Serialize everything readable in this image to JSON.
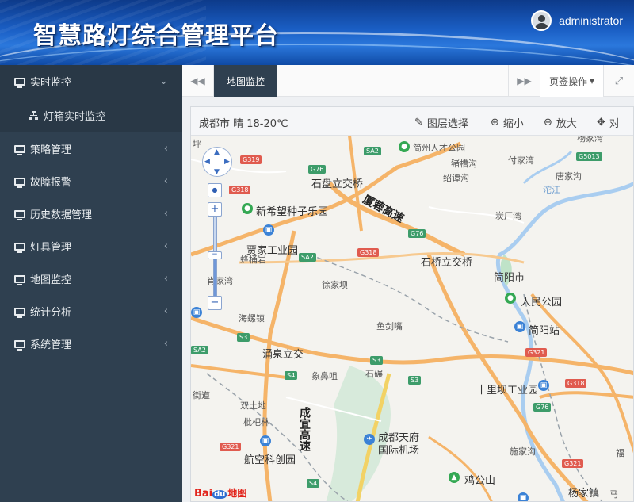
{
  "header": {
    "title": "智慧路灯综合管理平台",
    "username": "administrator"
  },
  "sidebar": {
    "items": [
      {
        "label": "实时监控",
        "chevron": "⌄",
        "active": true
      },
      {
        "label": "策略管理",
        "chevron": "‹"
      },
      {
        "label": "故障报警",
        "chevron": "‹"
      },
      {
        "label": "历史数据管理",
        "chevron": "‹"
      },
      {
        "label": "灯具管理",
        "chevron": "‹"
      },
      {
        "label": "地图监控",
        "chevron": "‹"
      },
      {
        "label": "统计分析",
        "chevron": "‹"
      },
      {
        "label": "系统管理",
        "chevron": "‹"
      }
    ],
    "subitem": {
      "label": "灯箱实时监控"
    }
  },
  "tabs": {
    "left_arrow": "◀◀",
    "active_tab": "地图监控",
    "right_arrow": "▶▶",
    "ops_label": "页签操作",
    "ops_caret": "▾",
    "fullscreen": "⤢"
  },
  "map": {
    "weather": "成都市 晴 18-20℃",
    "tools": {
      "layer": "图层选择",
      "zoom_out": "缩小",
      "zoom_in": "放大",
      "pan": "对"
    },
    "labels": {
      "l1": "简州人才公园",
      "l2": "猪槽沟",
      "l3": "付家湾",
      "l4": "杨家湾",
      "l5": "石盘立交桥",
      "l6": "绍谭沟",
      "l7": "唐家沟",
      "l8": "沱江",
      "l9": "新希望种子乐园",
      "l10": "炭厂湾",
      "l11": "厦蓉高速",
      "l12": "贾家工业园",
      "l13": "蜂桶岩",
      "l14": "石桥立交桥",
      "l15": "简阳市",
      "l16": "肖家湾",
      "l17": "徐家坝",
      "l18": "人民公园",
      "l19": "海螺镇",
      "l20": "简阳站",
      "l21": "鱼剑嘴",
      "l22": "涌泉立交",
      "l23": "象鼻咀",
      "l24": "石碾",
      "l25": "十里坝工业园",
      "l26": "双土地",
      "l27": "枇杷林",
      "l28": "成宜高速",
      "l29": "成都天府",
      "l30": "国际机场",
      "l31": "施家沟",
      "l32": "航空科创园",
      "l33": "鸡公山",
      "l34": "福",
      "l35": "杨家镇",
      "l36": "马",
      "l37": "坪",
      "l38": "街道"
    },
    "shields": {
      "s1": "G319",
      "s2": "SA2",
      "s3": "G76",
      "s4": "G318",
      "s5": "G5013",
      "s6": "G76",
      "s7": "SA2",
      "s8": "G318",
      "s9": "S3",
      "s10": "SA2",
      "s11": "S3",
      "s12": "S4",
      "s13": "S3",
      "s14": "G321",
      "s15": "G318",
      "s16": "G76",
      "s17": "G321",
      "s18": "S4",
      "s19": "G321"
    },
    "nav": {
      "up": "▲",
      "down": "▼",
      "left": "◀",
      "right": "▶",
      "zoom_plus": "+",
      "zoom_minus": "−",
      "dot": "●"
    },
    "logo": {
      "bai": "Bai",
      "du": "du",
      "text": "地图"
    }
  }
}
